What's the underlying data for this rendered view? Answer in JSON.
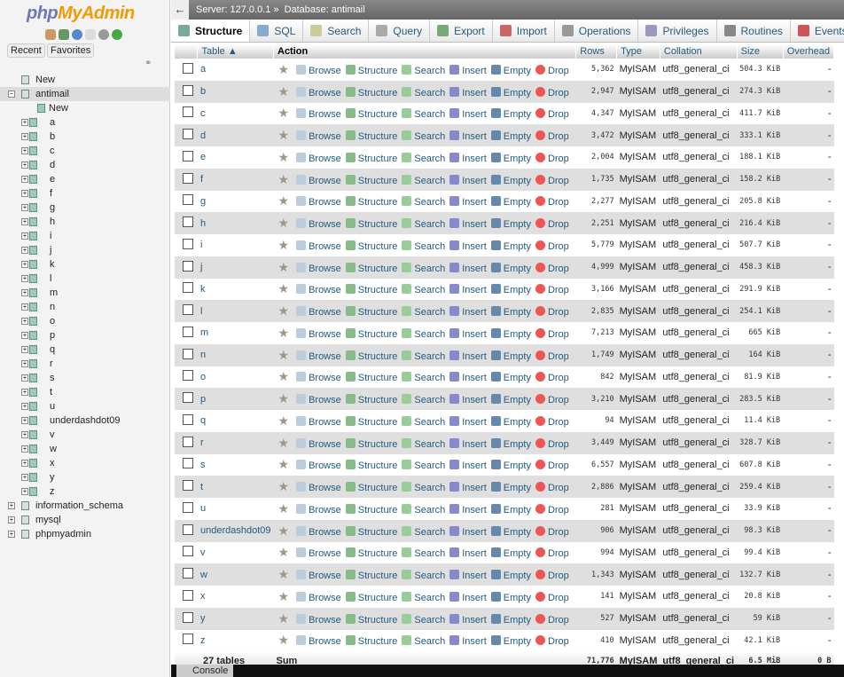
{
  "sidebar": {
    "logo_php": "php",
    "logo_myadmin": "MyAdmin",
    "recent": "Recent",
    "favorites": "Favorites",
    "new": "New",
    "databases": [
      {
        "name": "antimail",
        "expanded": true
      },
      {
        "name": "information_schema"
      },
      {
        "name": "mysql"
      },
      {
        "name": "phpmyadmin"
      }
    ],
    "db_new": "New"
  },
  "header": {
    "back": "←",
    "server": "Server: 127.0.0.1 »",
    "database": "Database: antimail"
  },
  "tabs": [
    {
      "label": "Structure",
      "active": true
    },
    {
      "label": "SQL"
    },
    {
      "label": "Search"
    },
    {
      "label": "Query"
    },
    {
      "label": "Export"
    },
    {
      "label": "Import"
    },
    {
      "label": "Operations"
    },
    {
      "label": "Privileges"
    },
    {
      "label": "Routines"
    },
    {
      "label": "Events"
    }
  ],
  "columns": {
    "table": "Table ▲",
    "action": "Action",
    "rows": "Rows",
    "type": "Type",
    "collation": "Collation",
    "size": "Size",
    "overhead": "Overhead"
  },
  "actions": {
    "browse": "Browse",
    "structure": "Structure",
    "search": "Search",
    "insert": "Insert",
    "empty": "Empty",
    "drop": "Drop"
  },
  "tables": [
    {
      "name": "a",
      "rows": "5,362",
      "size": "504.3 KiB"
    },
    {
      "name": "b",
      "rows": "2,947",
      "size": "274.3 KiB"
    },
    {
      "name": "c",
      "rows": "4,347",
      "size": "411.7 KiB"
    },
    {
      "name": "d",
      "rows": "3,472",
      "size": "333.1 KiB"
    },
    {
      "name": "e",
      "rows": "2,004",
      "size": "188.1 KiB"
    },
    {
      "name": "f",
      "rows": "1,735",
      "size": "158.2 KiB"
    },
    {
      "name": "g",
      "rows": "2,277",
      "size": "205.8 KiB"
    },
    {
      "name": "h",
      "rows": "2,251",
      "size": "216.4 KiB"
    },
    {
      "name": "i",
      "rows": "5,779",
      "size": "507.7 KiB"
    },
    {
      "name": "j",
      "rows": "4,999",
      "size": "458.3 KiB"
    },
    {
      "name": "k",
      "rows": "3,166",
      "size": "291.9 KiB"
    },
    {
      "name": "l",
      "rows": "2,835",
      "size": "254.1 KiB"
    },
    {
      "name": "m",
      "rows": "7,213",
      "size": "665 KiB"
    },
    {
      "name": "n",
      "rows": "1,749",
      "size": "164 KiB"
    },
    {
      "name": "o",
      "rows": "842",
      "size": "81.9 KiB"
    },
    {
      "name": "p",
      "rows": "3,210",
      "size": "283.5 KiB"
    },
    {
      "name": "q",
      "rows": "94",
      "size": "11.4 KiB"
    },
    {
      "name": "r",
      "rows": "3,449",
      "size": "328.7 KiB"
    },
    {
      "name": "s",
      "rows": "6,557",
      "size": "607.8 KiB"
    },
    {
      "name": "t",
      "rows": "2,886",
      "size": "259.4 KiB"
    },
    {
      "name": "u",
      "rows": "281",
      "size": "33.9 KiB"
    },
    {
      "name": "underdashdot09",
      "rows": "906",
      "size": "98.3 KiB"
    },
    {
      "name": "v",
      "rows": "994",
      "size": "99.4 KiB"
    },
    {
      "name": "w",
      "rows": "1,343",
      "size": "132.7 KiB"
    },
    {
      "name": "x",
      "rows": "141",
      "size": "20.8 KiB"
    },
    {
      "name": "y",
      "rows": "527",
      "size": "59 KiB"
    },
    {
      "name": "z",
      "rows": "410",
      "size": "42.1 KiB"
    }
  ],
  "table_type": "MyISAM",
  "table_collation": "utf8_general_ci",
  "table_overhead": "-",
  "footer": {
    "count": "27 tables",
    "sum": "Sum",
    "rows": "71,776",
    "type": "MyISAM",
    "collation": "utf8_general_ci",
    "size": "6.5 MiB",
    "overhead": "0 B"
  },
  "console": "Console"
}
